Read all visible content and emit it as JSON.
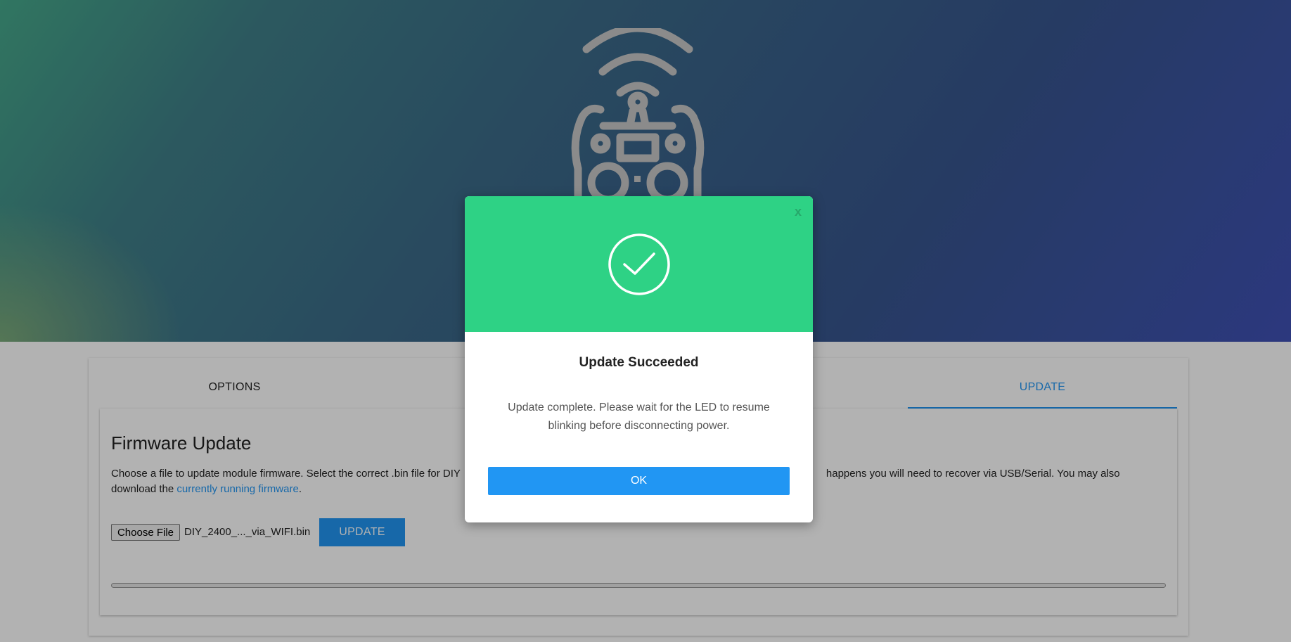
{
  "tabs": [
    {
      "label": "OPTIONS"
    },
    {
      "label": "UPDATE"
    }
  ],
  "firmware": {
    "title": "Firmware Update",
    "description_start": "Choose a file to update module firmware. Select the correct .bin file for DIY",
    "description_end": "happens you will need to recover via USB/Serial. You may also download the",
    "link_text": "currently running firmware",
    "description_tail": ".",
    "choose_file_label": "Choose File",
    "file_name": "DIY_2400_..._via_WIFI.bin",
    "update_button": "UPDATE",
    "progress": 0
  },
  "modal": {
    "close_label": "x",
    "title": "Update Succeeded",
    "message": "Update complete. Please wait for the LED to resume blinking before disconnecting power.",
    "ok_label": "OK"
  },
  "colors": {
    "accent": "#2196f3",
    "success": "#2ed285",
    "overlay": "rgba(0,0,0,0.3)"
  },
  "icons": {
    "logo": "radio-controller-wifi-icon",
    "success": "check-circle-icon"
  }
}
